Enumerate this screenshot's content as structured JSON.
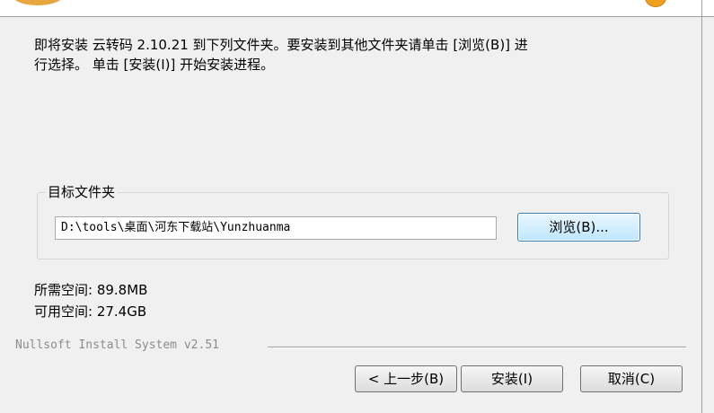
{
  "intro_text": "即将安装 云转码 2.10.21 到下列文件夹。要安装到其他文件夹请单击 [浏览(B)] 进\n行选择。 单击 [安装(I)] 开始安装进程。",
  "destination": {
    "group_label": "目标文件夹",
    "path_value": "D:\\tools\\桌面\\河东下载站\\Yunzhuanma",
    "browse_label": "浏览(B)..."
  },
  "space": {
    "required": "所需空间: 89.8MB",
    "available": "可用空间: 27.4GB"
  },
  "branding": "Nullsoft Install System v2.51",
  "buttons": {
    "back": "< 上一步(B)",
    "install": "安装(I)",
    "cancel": "取消(C)"
  },
  "colors": {
    "background": "#f0f0f0",
    "accent_orb": "#f0a020",
    "focused_button_border": "#3c7fb1"
  }
}
